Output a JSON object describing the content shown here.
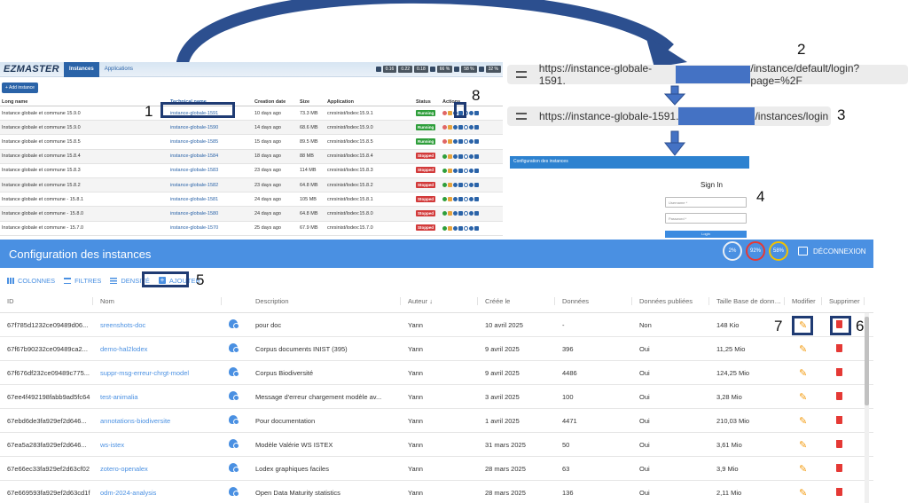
{
  "ezmaster": {
    "logo": "EZMASTER",
    "tabs": [
      "Instances",
      "Applications"
    ],
    "stats": [
      "0.16",
      "0.22",
      "0.18",
      "66 %",
      "58 %",
      "32 %"
    ],
    "add_button": "Add instance",
    "columns": [
      "Long name",
      "Technical name",
      "Creation date",
      "Size",
      "Application",
      "Status",
      "Actions"
    ],
    "rows": [
      {
        "long": "Instance globale et commune 15.9.0",
        "tech": "instance-globale-1591",
        "date": "10 days ago",
        "size": "73.3 MB",
        "app": "cnrsinist/lodex:15.9.1",
        "status": "Running"
      },
      {
        "long": "Instance globale et commune 15.9.0",
        "tech": "instance-globale-1590",
        "date": "14 days ago",
        "size": "68.6 MB",
        "app": "cnrsinist/lodex:15.9.0",
        "status": "Running"
      },
      {
        "long": "Instance globale et commune 15.8.5",
        "tech": "instance-globale-1585",
        "date": "15 days ago",
        "size": "89.5 MB",
        "app": "cnrsinist/lodex:15.8.5",
        "status": "Running"
      },
      {
        "long": "Instance globale et commune 15.8.4",
        "tech": "instance-globale-1584",
        "date": "18 days ago",
        "size": "88 MB",
        "app": "cnrsinist/lodex:15.8.4",
        "status": "Stopped"
      },
      {
        "long": "Instance globale et commune 15.8.3",
        "tech": "instance-globale-1583",
        "date": "23 days ago",
        "size": "114 MB",
        "app": "cnrsinist/lodex:15.8.3",
        "status": "Stopped"
      },
      {
        "long": "Instance globale et commune 15.8.2",
        "tech": "instance-globale-1582",
        "date": "23 days ago",
        "size": "64.8 MB",
        "app": "cnrsinist/lodex:15.8.2",
        "status": "Stopped"
      },
      {
        "long": "Instance globale et commune - 15.8.1",
        "tech": "instance-globale-1581",
        "date": "24 days ago",
        "size": "105 MB",
        "app": "cnrsinist/lodex:15.8.1",
        "status": "Stopped"
      },
      {
        "long": "Instance globale et commune - 15.8.0",
        "tech": "instance-globale-1580",
        "date": "24 days ago",
        "size": "64.8 MB",
        "app": "cnrsinist/lodex:15.8.0",
        "status": "Stopped"
      },
      {
        "long": "Instance globale et commune - 15.7.0",
        "tech": "instance-globale-1570",
        "date": "25 days ago",
        "size": "67.9 MB",
        "app": "cnrsinist/lodex:15.7.0",
        "status": "Stopped"
      }
    ]
  },
  "url1": {
    "prefix": "https://instance-globale-1591.",
    "suffix": "/instance/default/login?page=%2F"
  },
  "url2": {
    "prefix": "https://instance-globale-1591.",
    "suffix": "/instances/login"
  },
  "login": {
    "bar_title": "Configuration des instances",
    "title": "Sign In",
    "username_placeholder": "Username *",
    "password_placeholder": "Password *",
    "button": "Login"
  },
  "config": {
    "title": "Configuration des instances",
    "gauges": [
      "2%",
      "92%",
      "58%"
    ],
    "logout": "DÉCONNEXION",
    "toolbar": [
      "COLONNES",
      "FILTRES",
      "DENSITÉ",
      "AJOUTER"
    ],
    "columns": [
      "ID",
      "Nom",
      "Description",
      "Auteur",
      "Créée le",
      "Données",
      "Données publiées",
      "Taille Base de données",
      "Modifier",
      "Supprimer"
    ],
    "rows": [
      {
        "id": "67f785d1232ce09489d06...",
        "nom": "sreenshots-doc",
        "desc": "pour doc",
        "auteur": "Yann",
        "cree": "10 avril 2025",
        "donnees": "-",
        "pub": "Non",
        "taille": "148 Kio"
      },
      {
        "id": "67f67b90232ce09489ca2...",
        "nom": "demo-hal2lodex",
        "desc": "Corpus documents INIST (395)",
        "auteur": "Yann",
        "cree": "9 avril 2025",
        "donnees": "396",
        "pub": "Oui",
        "taille": "11,25 Mio"
      },
      {
        "id": "67f676df232ce09489c775...",
        "nom": "suppr-msg-erreur-chrgt-model",
        "desc": "Corpus Biodiversité",
        "auteur": "Yann",
        "cree": "9 avril 2025",
        "donnees": "4486",
        "pub": "Oui",
        "taille": "124,25 Mio"
      },
      {
        "id": "67ee4f492198fabb9ad5fc64",
        "nom": "test-animalia",
        "desc": "Message d'erreur chargement modèle av...",
        "auteur": "Yann",
        "cree": "3 avril 2025",
        "donnees": "100",
        "pub": "Oui",
        "taille": "3,28 Mio"
      },
      {
        "id": "67ebd6de3fa929ef2d646...",
        "nom": "annotations-biodiversite",
        "desc": "Pour documentation",
        "auteur": "Yann",
        "cree": "1 avril 2025",
        "donnees": "4471",
        "pub": "Oui",
        "taille": "210,03 Mio"
      },
      {
        "id": "67ea5a283fa929ef2d646...",
        "nom": "ws-istex",
        "desc": "Modèle Valérie WS ISTEX",
        "auteur": "Yann",
        "cree": "31 mars 2025",
        "donnees": "50",
        "pub": "Oui",
        "taille": "3,61 Mio"
      },
      {
        "id": "67e66ec33fa929ef2d63cf02",
        "nom": "zotero-openalex",
        "desc": "Lodex graphiques faciles",
        "auteur": "Yann",
        "cree": "28 mars 2025",
        "donnees": "63",
        "pub": "Oui",
        "taille": "3,9 Mio"
      },
      {
        "id": "67e669593fa929ef2d63cd1f",
        "nom": "odm-2024-analysis",
        "desc": "Open Data Maturity statistics",
        "auteur": "Yann",
        "cree": "28 mars 2025",
        "donnees": "136",
        "pub": "Oui",
        "taille": "2,11 Mio"
      }
    ]
  },
  "annotations": [
    "1",
    "2",
    "3",
    "4",
    "5",
    "6",
    "7",
    "8"
  ]
}
